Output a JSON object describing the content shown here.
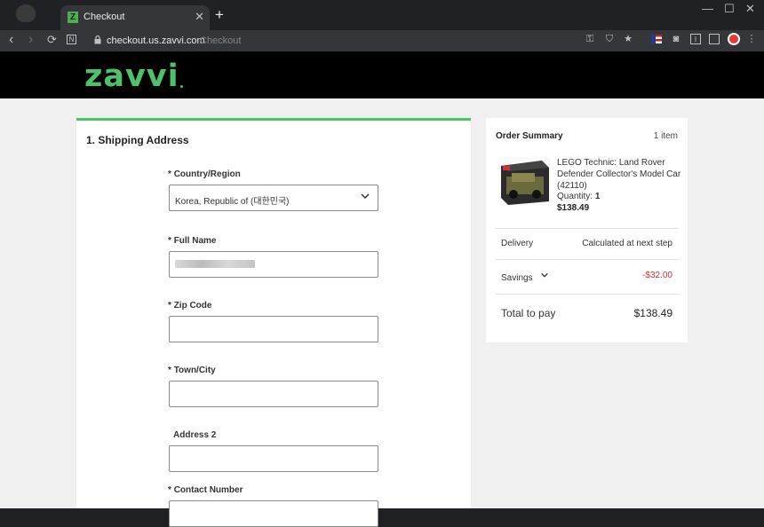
{
  "browser": {
    "tab_title": "Checkout",
    "tab_favicon": "Z",
    "url": "checkout.us.zavvi.com",
    "url_page_title": "Checkout"
  },
  "site": {
    "logo": "zavvi"
  },
  "form": {
    "section_title": "1. Shipping Address",
    "required_marker": "*",
    "fields": [
      {
        "label": "Country/Region",
        "required": true,
        "value": "Korea, Republic of (대한민국)"
      },
      {
        "label": "Full Name",
        "required": true,
        "value": ""
      },
      {
        "label": "Zip Code",
        "required": true,
        "value": ""
      },
      {
        "label": "Town/City",
        "required": true,
        "value": ""
      },
      {
        "label": "Address 2",
        "required": false,
        "value": ""
      },
      {
        "label": "Contact Number",
        "required": true,
        "value": ""
      }
    ]
  },
  "summary": {
    "title": "Order Summary",
    "count": "1 item",
    "product_name": "LEGO Technic: Land Rover Defender Collector's Model Car (42110)",
    "quantity_label": "Quantity:",
    "quantity": "1",
    "price": "$138.49",
    "delivery_label": "Delivery",
    "delivery_value": "Calculated at next step",
    "savings_label": "Savings",
    "savings_value": "-$32.00",
    "total_label": "Total to pay",
    "total_value": "$138.49"
  },
  "colors": {
    "brand_green": "#4dc26a",
    "savings_red": "#d32f2f"
  }
}
